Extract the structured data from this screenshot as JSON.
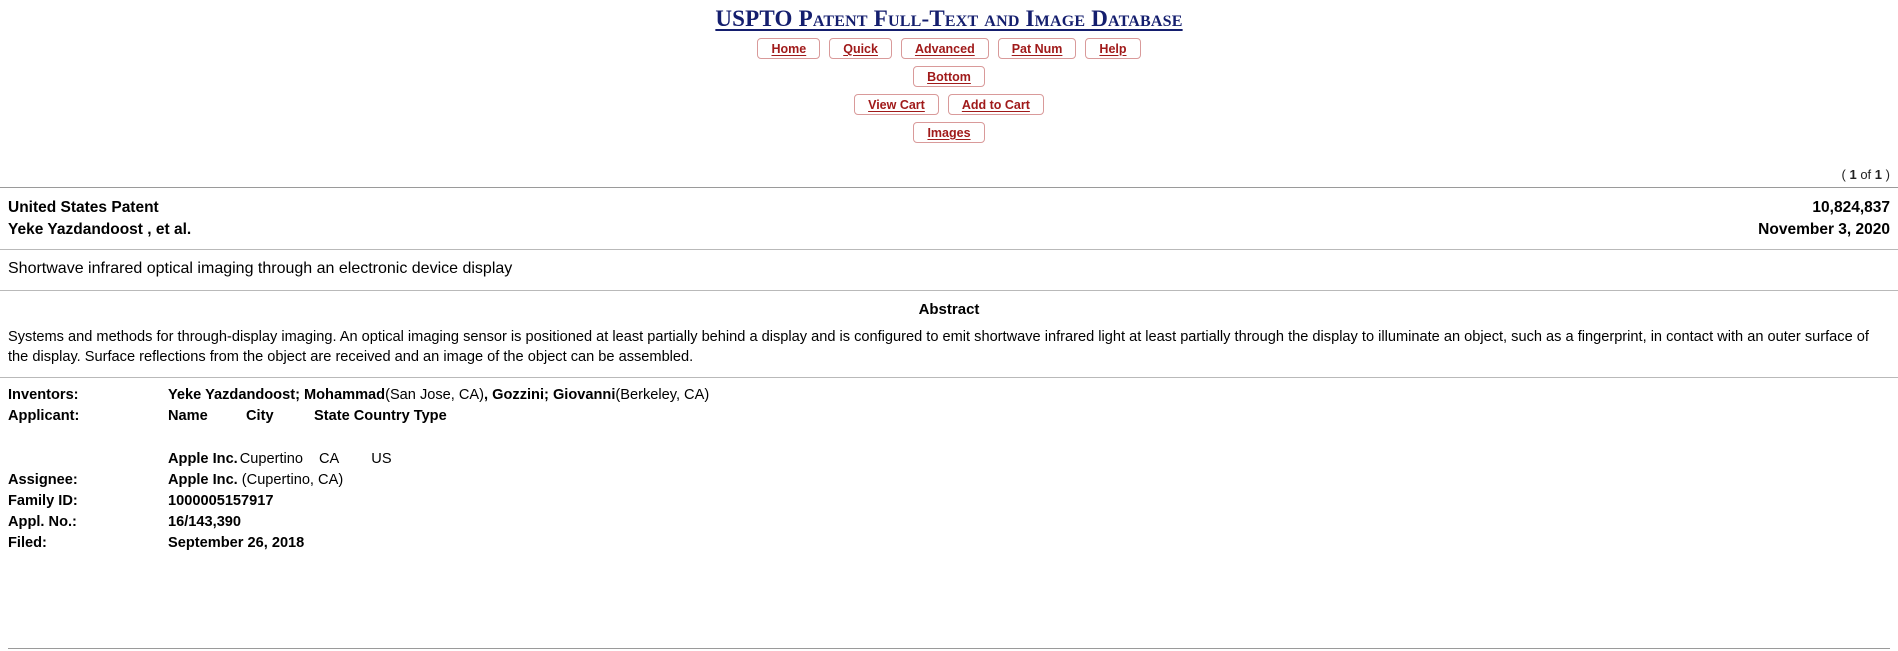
{
  "header": {
    "db_title": "USPTO Patent Full-Text and Image Database",
    "nav_row1": [
      {
        "label": "Home",
        "name": "home"
      },
      {
        "label": "Quick",
        "name": "quick"
      },
      {
        "label": "Advanced",
        "name": "advanced"
      },
      {
        "label": "Pat Num",
        "name": "pat-num"
      },
      {
        "label": "Help",
        "name": "help"
      }
    ],
    "nav_row2": [
      {
        "label": "Bottom",
        "name": "bottom"
      }
    ],
    "nav_row3": [
      {
        "label": "View Cart",
        "name": "view-cart"
      },
      {
        "label": "Add to Cart",
        "name": "add-to-cart"
      }
    ],
    "nav_row4": [
      {
        "label": "Images",
        "name": "images"
      }
    ],
    "paging": {
      "open_paren": "(",
      "current": "1",
      "of": "of",
      "total": "1",
      "close_paren": ")"
    }
  },
  "patent": {
    "authority": "United States Patent",
    "inventor_line": "Yeke Yazdandoost ,   et al.",
    "patent_number": "10,824,837",
    "issue_date": "November 3, 2020",
    "title": "Shortwave infrared optical imaging through an electronic device display",
    "abstract_heading": "Abstract",
    "abstract": "Systems and methods for through-display imaging. An optical imaging sensor is positioned at least partially behind a display and is configured to emit shortwave infrared light at least partially through the display to illuminate an object, such as a fingerprint, in contact with an outer surface of the display. Surface reflections from the object are received and an image of the object can be assembled."
  },
  "biblio": {
    "inventors_label": "Inventors:",
    "inventors_value_1_bold": "Yeke Yazdandoost; Mohammad",
    "inventors_value_1_loc": "(San Jose, CA)",
    "inventors_separator": ", ",
    "inventors_value_2_bold": "Gozzini; Giovanni",
    "inventors_value_2_loc": "(Berkeley, CA)",
    "applicant_label": "Applicant:",
    "applicant_columns": {
      "name": "Name",
      "city": "City",
      "state_country_type": "State Country Type"
    },
    "applicant_row": {
      "name": "Apple Inc.",
      "city": "Cupertino",
      "state": "CA",
      "country": "US"
    },
    "assignee_label": "Assignee:",
    "assignee_name": "Apple Inc.",
    "assignee_location": "(Cupertino, CA)",
    "family_id_label": "Family ID:",
    "family_id_value": "1000005157917",
    "appl_no_label": "Appl. No.:",
    "appl_no_value": "16/143,390",
    "filed_label": "Filed:",
    "filed_value": "September 26, 2018"
  },
  "colors": {
    "link_red": "#a01a1a",
    "button_border": "#d99a9a",
    "title_navy": "#141e6e",
    "rule_gray": "#9a9a9a",
    "page_background": "#ffffff"
  }
}
